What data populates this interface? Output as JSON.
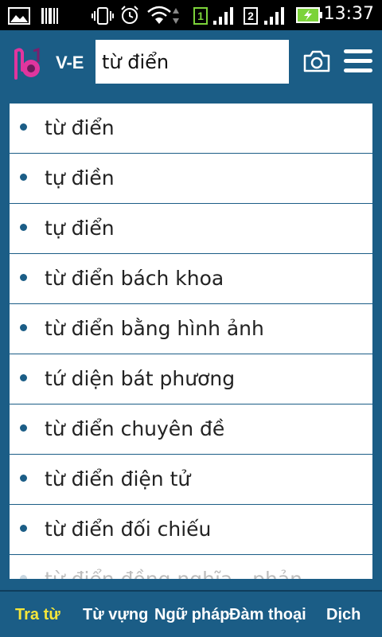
{
  "status": {
    "time": "13:37",
    "sim1": "1",
    "sim2": "2"
  },
  "header": {
    "lang": "V-E",
    "search_value": "từ điển",
    "camera_icon": "camera-icon",
    "menu_icon": "hamburger-menu-icon"
  },
  "results": [
    "từ điển",
    "tự điền",
    "tự điển",
    "từ điển bách khoa",
    "từ điển bằng hình ảnh",
    "tứ diện bát phương",
    "từ điển chuyên đề",
    "từ điển điện tử",
    "từ điển đối chiếu",
    "từ điển đồng nghĩa - phản"
  ],
  "tabs": [
    {
      "label": "Tra từ",
      "active": true
    },
    {
      "label": "Từ vựng",
      "active": false
    },
    {
      "label": "Ngữ pháp",
      "active": false
    },
    {
      "label": "Đàm thoại",
      "active": false
    },
    {
      "label": "Dịch",
      "active": false
    }
  ],
  "colors": {
    "primary": "#1b5d86",
    "active_tab": "#f5e63a",
    "logo": "#e0359e"
  }
}
